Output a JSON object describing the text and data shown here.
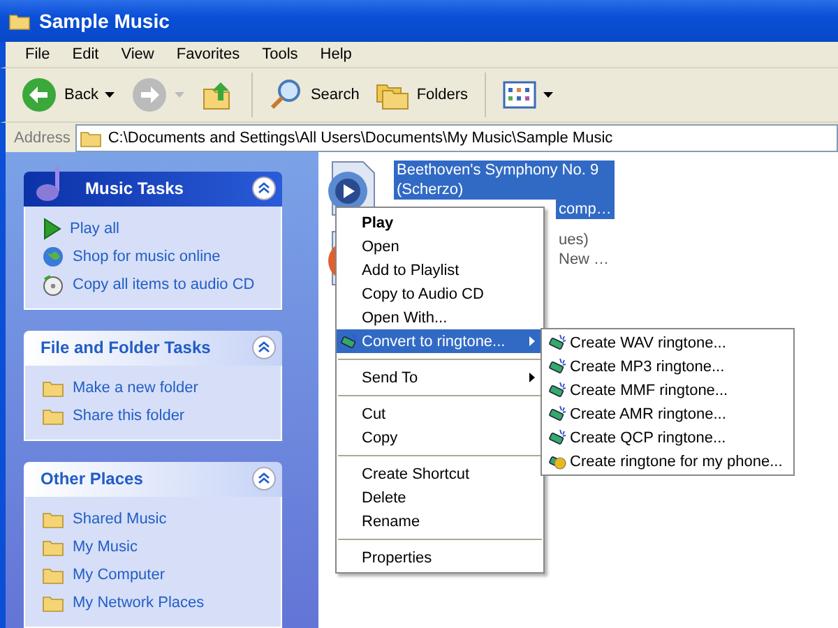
{
  "window": {
    "title": "Sample Music"
  },
  "menu_bar": [
    "File",
    "Edit",
    "View",
    "Favorites",
    "Tools",
    "Help"
  ],
  "toolbar": {
    "back": "Back",
    "forward_disabled": true,
    "search": "Search",
    "folders": "Folders"
  },
  "address": {
    "label": "Address",
    "value": "C:\\Documents and Settings\\All Users\\Documents\\My Music\\Sample Music"
  },
  "sidebar": [
    {
      "title": "Music Tasks",
      "kind": "music",
      "items": [
        "Play all",
        "Shop for music online",
        "Copy all items to audio CD"
      ]
    },
    {
      "title": "File and Folder Tasks",
      "kind": "plain",
      "items": [
        "Make a new folder",
        "Share this folder"
      ]
    },
    {
      "title": "Other Places",
      "kind": "plain",
      "items": [
        "Shared Music",
        "My Music",
        "My Computer",
        "My Network Places"
      ]
    }
  ],
  "files": [
    {
      "lines": [
        "Beethoven's Symphony No. 9",
        "(Scherzo)"
      ],
      "covered_lines": [
        "comp…"
      ],
      "selected": true
    },
    {
      "covered_lines": [
        "ues)",
        "New …"
      ],
      "selected": false
    }
  ],
  "context_menu": [
    {
      "kind": "item",
      "label": "Play",
      "bold": true,
      "selected": false
    },
    {
      "kind": "item",
      "label": "Open",
      "bold": false,
      "selected": false
    },
    {
      "kind": "item",
      "label": "Add to Playlist",
      "bold": false,
      "selected": false
    },
    {
      "kind": "item",
      "label": "Copy to Audio CD",
      "bold": false,
      "selected": false
    },
    {
      "kind": "item",
      "label": "Open With...",
      "bold": false,
      "selected": false
    },
    {
      "kind": "submenu",
      "label": "Convert to ringtone...",
      "bold": false,
      "selected": true
    },
    {
      "kind": "separator"
    },
    {
      "kind": "submenu",
      "label": "Send To",
      "bold": false,
      "selected": false
    },
    {
      "kind": "separator"
    },
    {
      "kind": "item",
      "label": "Cut",
      "bold": false,
      "selected": false
    },
    {
      "kind": "item",
      "label": "Copy",
      "bold": false,
      "selected": false
    },
    {
      "kind": "separator"
    },
    {
      "kind": "item",
      "label": "Create Shortcut",
      "bold": false,
      "selected": false
    },
    {
      "kind": "item",
      "label": "Delete",
      "bold": false,
      "selected": false
    },
    {
      "kind": "item",
      "label": "Rename",
      "bold": false,
      "selected": false
    },
    {
      "kind": "separator"
    },
    {
      "kind": "item",
      "label": "Properties",
      "bold": false,
      "selected": false
    }
  ],
  "submenu": [
    {
      "kind": "format",
      "label": "Create WAV ringtone..."
    },
    {
      "kind": "format",
      "label": "Create MP3 ringtone..."
    },
    {
      "kind": "format",
      "label": "Create MMF ringtone..."
    },
    {
      "kind": "format",
      "label": "Create AMR ringtone..."
    },
    {
      "kind": "format",
      "label": "Create QCP ringtone..."
    },
    {
      "kind": "phone",
      "label": "Create ringtone for my phone..."
    }
  ]
}
